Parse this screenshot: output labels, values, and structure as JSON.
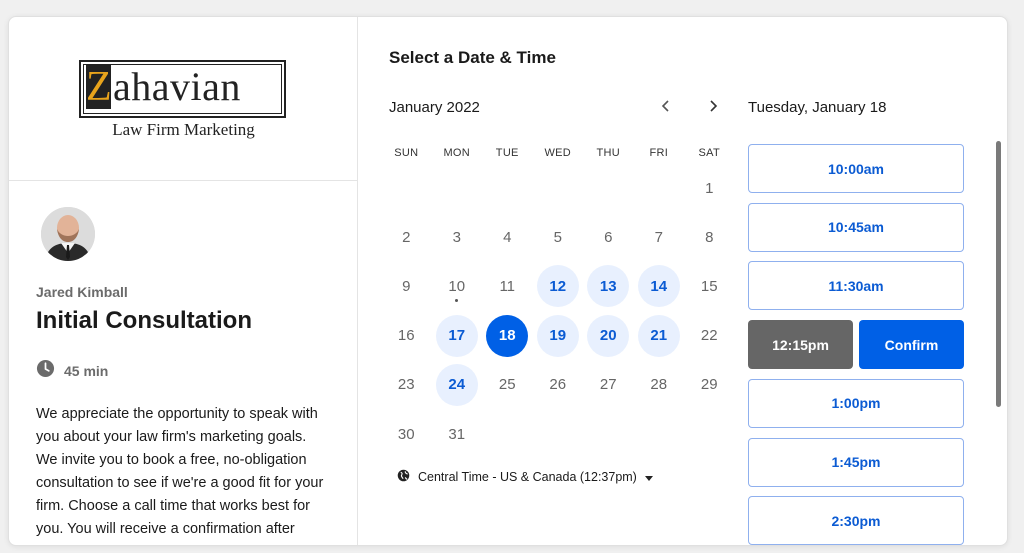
{
  "brand": {
    "logo_initial": "Z",
    "logo_rest": "ahavian",
    "logo_sub": "Law Firm Marketing",
    "accent": "#0060e6",
    "logo_gold": "#e8a41c"
  },
  "host_name": "Jared Kimball",
  "event_title": "Initial Consultation",
  "duration": {
    "icon": "clock-icon",
    "label": "45 min"
  },
  "description": "We appreciate the opportunity to speak with you about your law firm's marketing goals. We invite you to book a free, no-obligation consultation to see if we're a good fit for your firm. Choose a call time that works best for you. You will receive a confirmation after booking the meeting and",
  "page_title": "Select a Date & Time",
  "calendar": {
    "month_label": "January 2022",
    "weekdays": [
      "SUN",
      "MON",
      "TUE",
      "WED",
      "THU",
      "FRI",
      "SAT"
    ],
    "weeks": [
      [
        null,
        null,
        null,
        null,
        null,
        null,
        "1"
      ],
      [
        "2",
        "3",
        "4",
        "5",
        "6",
        "7",
        "8"
      ],
      [
        "9",
        "10",
        "11",
        "12",
        "13",
        "14",
        "15"
      ],
      [
        "16",
        "17",
        "18",
        "19",
        "20",
        "21",
        "22"
      ],
      [
        "23",
        "24",
        "25",
        "26",
        "27",
        "28",
        "29"
      ],
      [
        "30",
        "31",
        null,
        null,
        null,
        null,
        null
      ]
    ],
    "available": [
      "12",
      "13",
      "14",
      "17",
      "18",
      "19",
      "20",
      "21",
      "24"
    ],
    "selected": "18",
    "today": "10"
  },
  "timezone": {
    "icon": "globe-icon",
    "label": "Central Time - US & Canada (12:37pm)"
  },
  "slots": {
    "date_label": "Tuesday, January 18",
    "times": [
      "10:00am",
      "10:45am",
      "11:30am",
      "12:15pm",
      "1:00pm",
      "1:45pm",
      "2:30pm"
    ],
    "selected": "12:15pm",
    "confirm_label": "Confirm"
  }
}
